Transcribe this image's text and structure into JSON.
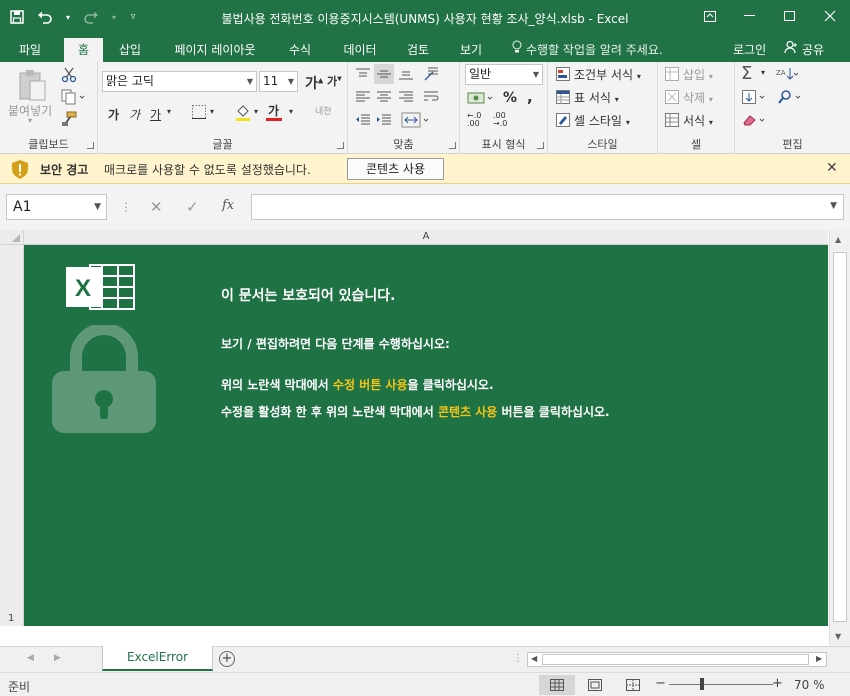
{
  "window": {
    "title": "불법사용 전화번호 이용중지시스템(UNMS) 사용자 현황 조사_양식.xlsb - Excel"
  },
  "ribbon_tabs": [
    {
      "label": "파일"
    },
    {
      "label": "홈"
    },
    {
      "label": "삽입"
    },
    {
      "label": "페이지 레이아웃"
    },
    {
      "label": "수식"
    },
    {
      "label": "데이터"
    },
    {
      "label": "검토"
    },
    {
      "label": "보기"
    }
  ],
  "tell_me": "수행할 작업을 알려 주세요.",
  "signin": "로그인",
  "share": "공유",
  "ribbon": {
    "clipboard": {
      "label": "클립보드",
      "paste": "붙여넣기"
    },
    "font": {
      "label": "글꼴",
      "font_name": "맑은 고딕",
      "font_size": "11",
      "bold": "가",
      "italic": "가",
      "underline": "가",
      "font_color": "가",
      "phonetic": "내천"
    },
    "alignment": {
      "label": "맞춤"
    },
    "number": {
      "label": "표시 형식",
      "format": "일반",
      "percent": "%"
    },
    "styles": {
      "label": "스타일",
      "conditional": "조건부 서식",
      "table": "표 서식",
      "cell_styles": "셀 스타일"
    },
    "cells": {
      "label": "셀",
      "insert": "삽입",
      "delete": "삭제",
      "format": "서식"
    },
    "editing": {
      "label": "편집"
    }
  },
  "security_bar": {
    "title": "보안 경고",
    "message": "매크로를 사용할 수 없도록 설정했습니다.",
    "button": "콘텐츠 사용"
  },
  "formula_bar": {
    "name_box": "A1",
    "fx": "fx",
    "value": ""
  },
  "grid": {
    "column_header": "A",
    "row_number": "1"
  },
  "protected": {
    "title": "이 문서는 보호되어 있습니다.",
    "intro": "보기 / 편집하려면 다음 단계를 수행하십시오:",
    "step1_pre": "위의 노란색 막대에서 ",
    "step1_hl": "수정 버튼 사용",
    "step1_post": "을 클릭하십시오.",
    "step2_pre": "수정을 활성화 한 후 위의 노란색 막대에서 ",
    "step2_hl": "콘텐츠 사용",
    "step2_bold": " 버튼",
    "step2_post": "을 클릭하십시오.",
    "logo_letter": "X"
  },
  "sheet_tabs": [
    {
      "label": "ExcelError"
    }
  ],
  "status": {
    "ready": "준비",
    "zoom": "70 %",
    "zoom_level_percent": 70
  },
  "colors": {
    "brand": "#217346",
    "sheet_bg": "#1f7244",
    "highlight": "#f5c518",
    "security_bar": "#fff4ce"
  }
}
